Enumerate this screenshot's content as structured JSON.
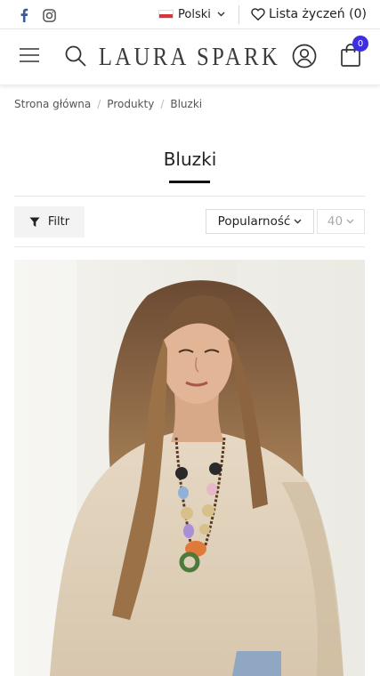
{
  "topbar": {
    "icons": [
      "facebook-icon",
      "instagram-icon"
    ],
    "language": "Polski",
    "wishlist_label": "Lista życzeń (0)"
  },
  "header": {
    "logo": "LAURA SPARK",
    "cart_count": "0",
    "icons": [
      "menu-icon",
      "search-icon",
      "user-icon",
      "shopping-bag-icon"
    ]
  },
  "breadcrumb": [
    "Strona główna",
    "Produkty",
    "Bluzki"
  ],
  "page_title": "Bluzki",
  "toolbar": {
    "filter_label": "Filtr",
    "sort_value": "Popularność",
    "per_page_value": "40"
  },
  "colors": {
    "accent_badge": "#3d2de3",
    "facebook": "#3b5998",
    "instagram": "#555555"
  }
}
